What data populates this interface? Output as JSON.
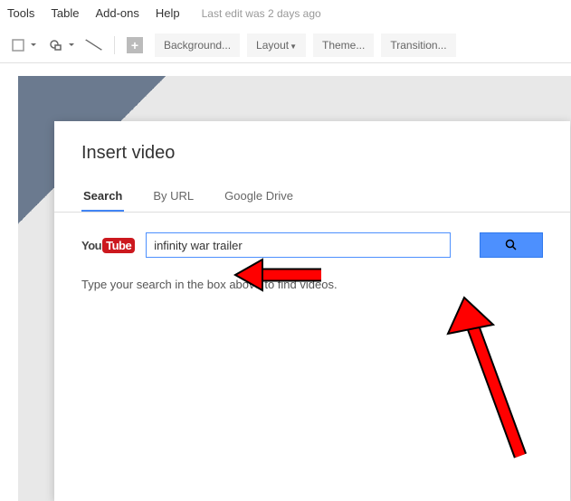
{
  "menubar": {
    "tools": "Tools",
    "table": "Table",
    "addons": "Add-ons",
    "help": "Help",
    "edit_info": "Last edit was 2 days ago"
  },
  "toolbar": {
    "background": "Background...",
    "layout": "Layout",
    "theme": "Theme...",
    "transition": "Transition..."
  },
  "modal": {
    "title": "Insert video",
    "tabs": {
      "search": "Search",
      "byurl": "By URL",
      "drive": "Google Drive"
    },
    "youtube": {
      "you": "You",
      "tube": "Tube"
    },
    "search_value": "infinity war trailer",
    "hint": "Type your search in the box above to find videos."
  }
}
